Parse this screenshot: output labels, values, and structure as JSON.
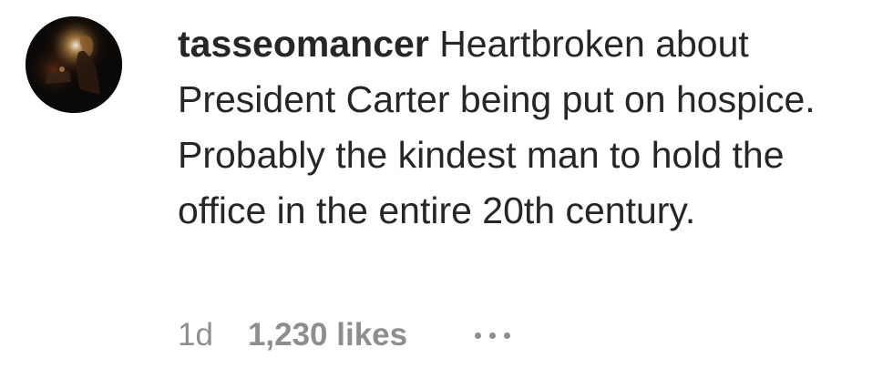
{
  "comment": {
    "username": "tasseomancer",
    "text": "Heartbroken about President Carter being put on hospice. Probably the kindest man to hold the office in the entire 20th century.",
    "timestamp": "1d",
    "likes": "1,230 likes",
    "more_icon": "more-options-icon"
  },
  "colors": {
    "text": "#262626",
    "secondary": "#8e8e8e",
    "background": "#ffffff"
  }
}
